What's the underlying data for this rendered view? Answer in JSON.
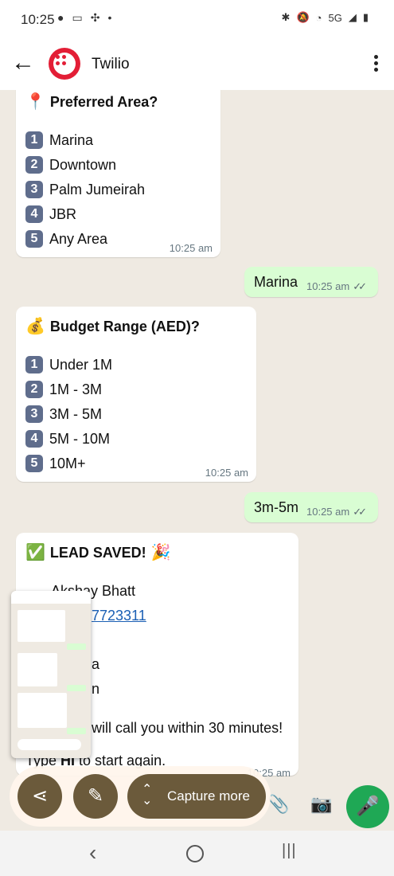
{
  "status": {
    "time": "10:25",
    "left_icons": [
      "chat-icon",
      "message-icon",
      "id-icon",
      "fan-icon",
      "dot-icon"
    ],
    "network": "5G"
  },
  "header": {
    "contact": "Twilio"
  },
  "messages": {
    "area": {
      "title": "Preferred Area?",
      "options": [
        {
          "num": "1",
          "label": "Marina"
        },
        {
          "num": "2",
          "label": "Downtown"
        },
        {
          "num": "3",
          "label": "Palm Jumeirah"
        },
        {
          "num": "4",
          "label": "JBR"
        },
        {
          "num": "5",
          "label": "Any Area"
        }
      ],
      "time": "10:25 am"
    },
    "reply1": {
      "text": "Marina",
      "time": "10:25 am"
    },
    "budget": {
      "title": "Budget Range (AED)?",
      "options": [
        {
          "num": "1",
          "label": "Under 1M"
        },
        {
          "num": "2",
          "label": "1M - 3M"
        },
        {
          "num": "3",
          "label": "3M - 5M"
        },
        {
          "num": "4",
          "label": "5M - 10M"
        },
        {
          "num": "5",
          "label": "10M+"
        }
      ],
      "time": "10:25 am"
    },
    "reply2": {
      "text": "3m-5m",
      "time": "10:25 am"
    },
    "lead": {
      "title": "LEAD SAVED!",
      "name": "Akshay Bhatt",
      "phone_partial": "7723311",
      "line_a": "a",
      "line_b": "n",
      "callback": "will call you within 30 minutes!",
      "restart_pre": "Type ",
      "restart_bold": "HI",
      "restart_post": " to start again.",
      "time": "10:25 am"
    }
  },
  "capture": {
    "more_label": "Capture more"
  },
  "colors": {
    "accent_green": "#1fa855",
    "capture_brown": "#6b5a3b",
    "out_bubble": "#d9fdd3"
  }
}
